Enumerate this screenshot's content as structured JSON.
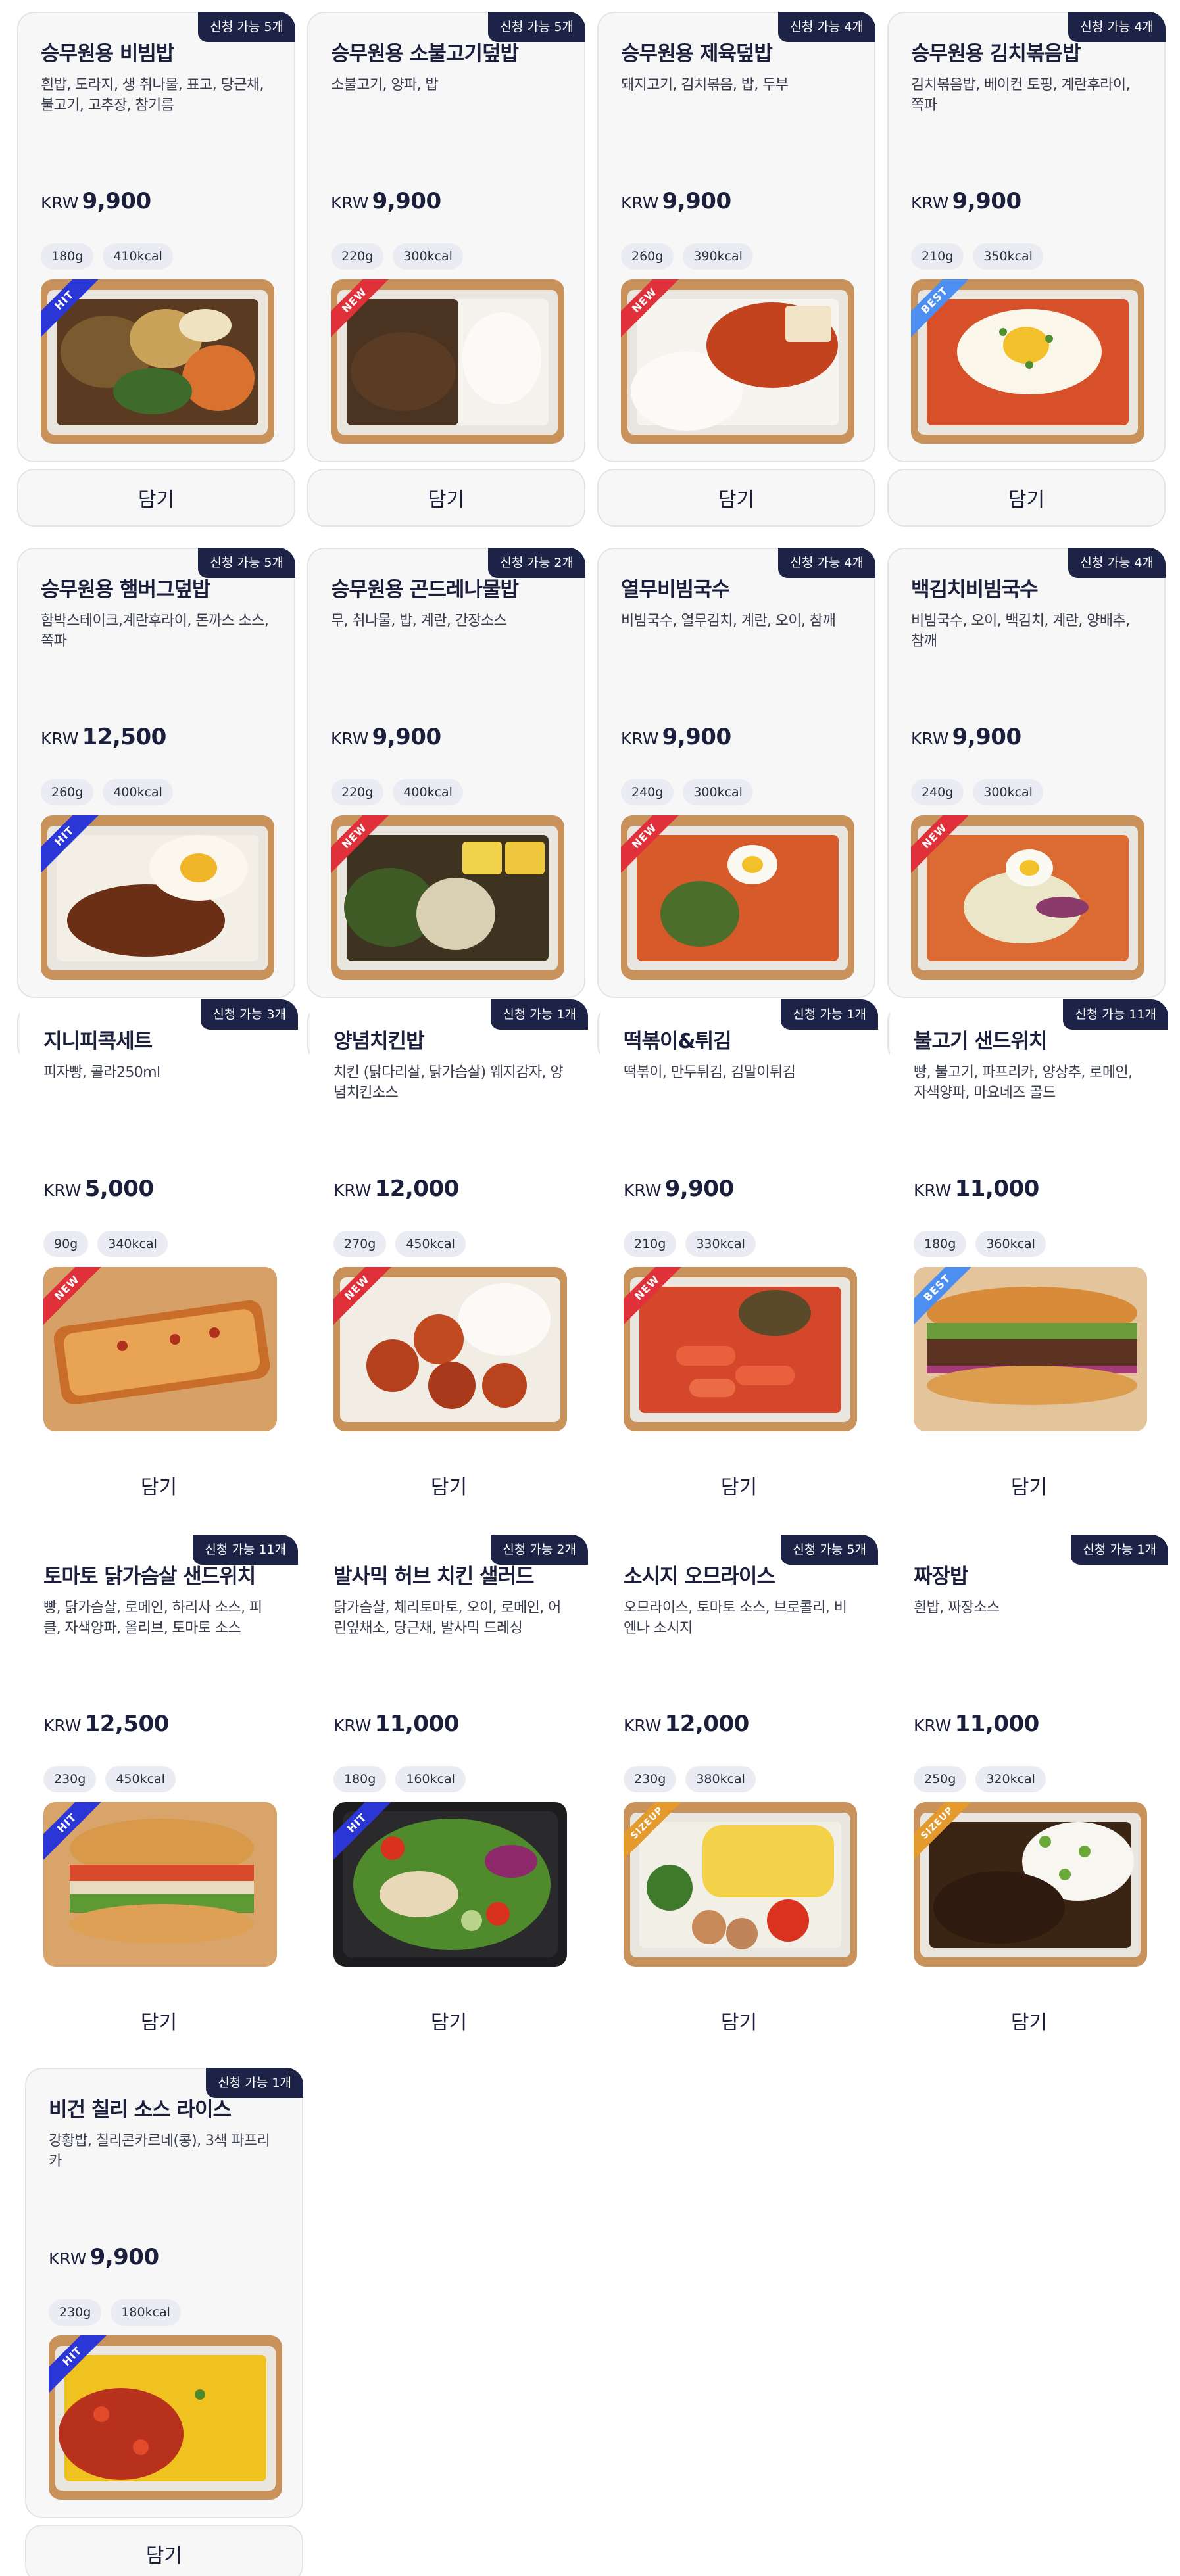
{
  "cart_label": "담기",
  "currency": "KRW",
  "products": [
    {
      "name": "승무원용 비빔밥",
      "desc": "흰밥, 도라지, 생 취나물, 표고, 당근채, 불고기, 고추장, 참기름",
      "price": "9,900",
      "badge": "신청 가능 5개",
      "weight": "180g",
      "kcal": "410kcal",
      "tag": "HIT",
      "food": "bibimbap"
    },
    {
      "name": "승무원용 소불고기덮밥",
      "desc": "소불고기, 양파, 밥",
      "price": "9,900",
      "badge": "신청 가능 5개",
      "weight": "220g",
      "kcal": "300kcal",
      "tag": "NEW",
      "food": "bulgogi-rice"
    },
    {
      "name": "승무원용 제육덮밥",
      "desc": "돼지고기, 김치볶음, 밥, 두부",
      "price": "9,900",
      "badge": "신청 가능 4개",
      "weight": "260g",
      "kcal": "390kcal",
      "tag": "NEW",
      "food": "jeyuk-rice"
    },
    {
      "name": "승무원용 김치볶음밥",
      "desc": "김치볶음밥, 베이컨 토핑, 계란후라이, 쪽파",
      "price": "9,900",
      "badge": "신청 가능 4개",
      "weight": "210g",
      "kcal": "350kcal",
      "tag": "BEST",
      "food": "kimchi-fried-rice"
    },
    {
      "name": "승무원용 햄버그덮밥",
      "desc": "함박스테이크,계란후라이, 돈까스 소스, 쪽파",
      "price": "12,500",
      "badge": "신청 가능 5개",
      "weight": "260g",
      "kcal": "400kcal",
      "tag": "HIT",
      "food": "hamburg-rice"
    },
    {
      "name": "승무원용 곤드레나물밥",
      "desc": "무, 취나물, 밥, 계란, 간장소스",
      "price": "9,900",
      "badge": "신청 가능 2개",
      "weight": "220g",
      "kcal": "400kcal",
      "tag": "NEW",
      "food": "gondre-rice"
    },
    {
      "name": "열무비빔국수",
      "desc": "비빔국수, 열무김치, 계란, 오이, 참깨",
      "price": "9,900",
      "badge": "신청 가능 4개",
      "weight": "240g",
      "kcal": "300kcal",
      "tag": "NEW",
      "food": "yeolmu-noodles"
    },
    {
      "name": "백김치비빔국수",
      "desc": "비빔국수, 오이, 백김치, 계란, 양배추, 참깨",
      "price": "9,900",
      "badge": "신청 가능 4개",
      "weight": "240g",
      "kcal": "300kcal",
      "tag": "NEW",
      "food": "baekkimchi-noodles"
    },
    {
      "name": "지니피콕세트",
      "desc": "피자빵, 콜라250ml",
      "price": "5,000",
      "badge": "신청 가능 3개",
      "weight": "90g",
      "kcal": "340kcal",
      "tag": "NEW",
      "food": "pizza-bread"
    },
    {
      "name": "양념치킨밥",
      "desc": "치킨 (닭다리살, 닭가슴살) 웨지감자, 양념치킨소스",
      "price": "12,000",
      "badge": "신청 가능 1개",
      "weight": "270g",
      "kcal": "450kcal",
      "tag": "NEW",
      "food": "chicken-rice"
    },
    {
      "name": "떡볶이&튀김",
      "desc": "떡볶이, 만두튀김, 김말이튀김",
      "price": "9,900",
      "badge": "신청 가능 1개",
      "weight": "210g",
      "kcal": "330kcal",
      "tag": "NEW",
      "food": "tteokbokki"
    },
    {
      "name": "불고기 샌드위치",
      "desc": "빵, 불고기, 파프리카, 양상추, 로메인, 자색양파, 마요네즈 골드",
      "price": "11,000",
      "badge": "신청 가능 11개",
      "weight": "180g",
      "kcal": "360kcal",
      "tag": "BEST",
      "food": "bulgogi-sandwich"
    },
    {
      "name": "토마토 닭가슴살 샌드위치",
      "desc": "빵, 닭가슴살, 로메인, 하리사 소스, 피클, 자색양파, 올리브, 토마토 소스",
      "price": "12,500",
      "badge": "신청 가능 11개",
      "weight": "230g",
      "kcal": "450kcal",
      "tag": "HIT",
      "food": "chicken-sandwich"
    },
    {
      "name": "발사믹 허브 치킨 샐러드",
      "desc": "닭가슴살, 체리토마토, 오이, 로메인, 어린잎채소, 당근채, 발사믹 드레싱",
      "price": "11,000",
      "badge": "신청 가능 2개",
      "weight": "180g",
      "kcal": "160kcal",
      "tag": "HIT",
      "food": "chicken-salad"
    },
    {
      "name": "소시지 오므라이스",
      "desc": "오므라이스, 토마토 소스, 브로콜리, 비엔나 소시지",
      "price": "12,000",
      "badge": "신청 가능 5개",
      "weight": "230g",
      "kcal": "380kcal",
      "tag": "SIZEUP",
      "food": "omurice"
    },
    {
      "name": "짜장밥",
      "desc": "흰밥, 짜장소스",
      "price": "11,000",
      "badge": "신청 가능 1개",
      "weight": "250g",
      "kcal": "320kcal",
      "tag": "SIZEUP",
      "food": "jjajang-rice"
    },
    {
      "name": "비건 칠리 소스 라이스",
      "desc": "강황밥, 칠리콘카르네(콩), 3색 파프리카",
      "price": "9,900",
      "badge": "신청 가능 1개",
      "weight": "230g",
      "kcal": "180kcal",
      "tag": "HIT",
      "food": "vegan-chili-rice"
    }
  ]
}
